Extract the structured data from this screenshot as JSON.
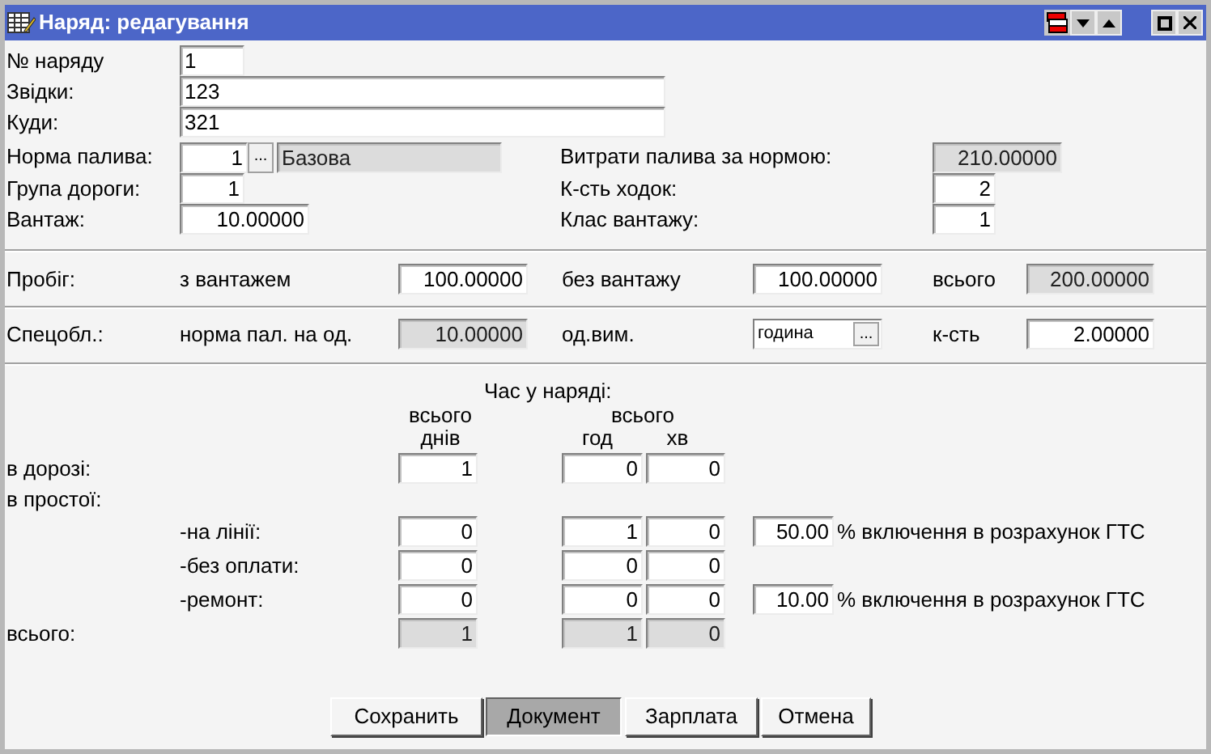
{
  "window": {
    "title": "Наряд: редагування"
  },
  "order_no": {
    "label": "№ наряду",
    "field": {
      "value": "1",
      "disabled": false
    }
  },
  "from": {
    "label": "Звідки:",
    "field": {
      "value": "123",
      "disabled": false
    }
  },
  "to": {
    "label": "Куди:",
    "field": {
      "value": "321",
      "disabled": false
    }
  },
  "fuel_norm": {
    "label": "Норма палива:",
    "field": {
      "value": "1",
      "disabled": false
    },
    "button": "...",
    "name": {
      "value": "Базова",
      "disabled": true
    }
  },
  "fuel_consumption": {
    "label": "Витрати палива за нормою:",
    "field": {
      "value": "210.00000",
      "disabled": true
    }
  },
  "road_group": {
    "label": "Група дороги:",
    "field": {
      "value": "1",
      "disabled": false
    }
  },
  "trips": {
    "label": "К-сть ходок:",
    "field": {
      "value": "2",
      "disabled": false
    }
  },
  "cargo": {
    "label": "Вантаж:",
    "field": {
      "value": "10.00000",
      "disabled": false
    }
  },
  "cargo_class": {
    "label": "Клас вантажу:",
    "field": {
      "value": "1",
      "disabled": false
    }
  },
  "mileage": {
    "label": "Пробіг:",
    "fields": [
      {
        "label": "з вантажем",
        "value": "100.00000",
        "disabled": false,
        "kind": "text"
      },
      {
        "label": "без вантажу",
        "value": "100.00000",
        "disabled": false,
        "kind": "text"
      },
      {
        "label": "всього",
        "value": "200.00000",
        "disabled": true,
        "kind": "text"
      }
    ]
  },
  "special": {
    "label": "Спецобл.:",
    "fields": [
      {
        "label": "норма пал. на од.",
        "value": "10.00000",
        "disabled": true,
        "kind": "text"
      },
      {
        "label": "од.вим.",
        "value": "година",
        "disabled": false,
        "kind": "lookup",
        "button": "..."
      },
      {
        "label": "к-сть",
        "value": "2.00000",
        "disabled": false,
        "kind": "text"
      }
    ]
  },
  "time": {
    "title": "Час у наряді:",
    "days_top": "всього",
    "days": "днів",
    "hm_top": "всього",
    "hours": "год",
    "minutes": "хв",
    "rows": [
      {
        "label": "в дорозі:",
        "days": {
          "value": "1",
          "disabled": false
        },
        "hours": {
          "value": "0",
          "disabled": false
        },
        "minutes": {
          "value": "0",
          "disabled": false
        }
      },
      {
        "label": "в простої:",
        "children": [
          {
            "label": "-на лінії:",
            "days": {
              "value": "0",
              "disabled": false
            },
            "hours": {
              "value": "1",
              "disabled": false
            },
            "minutes": {
              "value": "0",
              "disabled": false
            },
            "percent": {
              "value": "50.00",
              "disabled": false
            },
            "percent_label": "% включення в розрахунок ГТС"
          },
          {
            "label": "-без оплати:",
            "days": {
              "value": "0",
              "disabled": false
            },
            "hours": {
              "value": "0",
              "disabled": false
            },
            "minutes": {
              "value": "0",
              "disabled": false
            }
          },
          {
            "label": "-ремонт:",
            "days": {
              "value": "0",
              "disabled": false
            },
            "hours": {
              "value": "0",
              "disabled": false
            },
            "minutes": {
              "value": "0",
              "disabled": false
            },
            "percent": {
              "value": "10.00",
              "disabled": false
            },
            "percent_label": "% включення в розрахунок ГТС"
          }
        ]
      },
      {
        "label": "всього:",
        "days": {
          "value": "1",
          "disabled": true
        },
        "hours": {
          "value": "1",
          "disabled": true
        },
        "minutes": {
          "value": "0",
          "disabled": true
        }
      }
    ]
  },
  "buttons": [
    {
      "label": "Сохранить",
      "selected": false
    },
    {
      "label": "Документ",
      "selected": true
    },
    {
      "label": "Зарплата",
      "selected": false
    },
    {
      "label": "Отмена",
      "selected": false
    }
  ]
}
